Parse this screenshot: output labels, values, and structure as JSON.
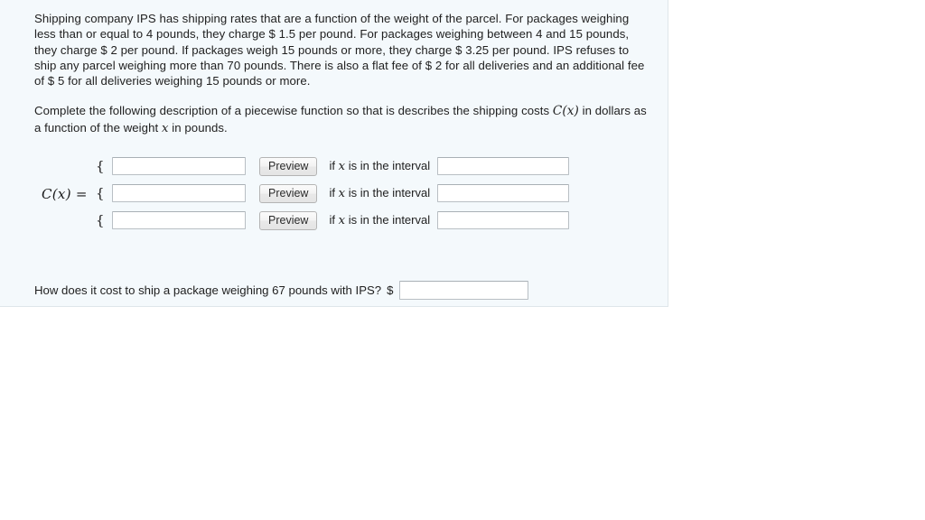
{
  "panel": {
    "paragraphs": [
      "Shipping company IPS has shipping rates that are a function of the weight of the parcel. For packages weighing less than or equal to 4 pounds, they charge $ 1.5 per pound. For packages weighing between 4 and 15 pounds, they charge $ 2 per pound. If packages weigh 15 pounds or more, they charge $ 3.25 per pound. IPS refuses to ship any parcel weighing more than 70 pounds. There is also a flat fee of $ 2 for all deliveries and an additional fee of $ 5 for all deliveries weighing 15 pounds or more."
    ],
    "instruction": {
      "before_fn": "Complete the following description of a piecewise function so that is describes the shipping costs ",
      "fn_label": "C(x)",
      "after_fn": " in dollars as a function of the weight ",
      "var_label": "x",
      "tail": " in pounds."
    },
    "piecewise": {
      "function_label": "C(x) =",
      "brace": "{",
      "rows": [
        {
          "expression_value": "",
          "expression_placeholder": "",
          "preview_label": "Preview",
          "if_prefix": "if ",
          "if_var": "x",
          "if_suffix": " is in the interval",
          "interval_value": "",
          "interval_placeholder": ""
        },
        {
          "expression_value": "",
          "expression_placeholder": "",
          "preview_label": "Preview",
          "if_prefix": "if ",
          "if_var": "x",
          "if_suffix": " is in the interval",
          "interval_value": "",
          "interval_placeholder": ""
        },
        {
          "expression_value": "",
          "expression_placeholder": "",
          "preview_label": "Preview",
          "if_prefix": "if ",
          "if_var": "x",
          "if_suffix": " is in the interval",
          "interval_value": "",
          "interval_placeholder": ""
        }
      ]
    },
    "final_question": {
      "text": "How does it cost to ship a package weighing 67 pounds with IPS?",
      "currency_symbol": "$",
      "answer_value": "",
      "answer_placeholder": ""
    }
  },
  "colors": {
    "panel_background": "#f4f9fc",
    "panel_border": "#dfe6ea",
    "text": "#212121",
    "input_border": "#b9bfc4",
    "button_border": "#b4b4b4"
  }
}
